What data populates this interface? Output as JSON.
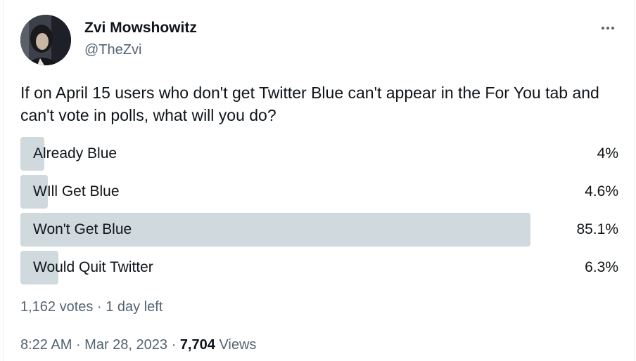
{
  "author": {
    "name": "Zvi Mowshowitz",
    "handle": "@TheZvi"
  },
  "tweet": {
    "text": "If on April 15 users who don't get Twitter Blue can't appear in the For You tab and can't vote in polls, what will you do?"
  },
  "poll": {
    "options": [
      {
        "label": "Already Blue",
        "percent_label": "4%",
        "percent": 4.0
      },
      {
        "label": "WIll Get Blue",
        "percent_label": "4.6%",
        "percent": 4.6
      },
      {
        "label": "Won't Get Blue",
        "percent_label": "85.1%",
        "percent": 85.1
      },
      {
        "label": "Would Quit Twitter",
        "percent_label": "6.3%",
        "percent": 6.3
      }
    ],
    "votes": "1,162 votes",
    "separator": " · ",
    "time_left": "1 day left"
  },
  "meta": {
    "time": "8:22 AM",
    "separator": " · ",
    "date": "Mar 28, 2023",
    "views_count": "7,704",
    "views_label": "Views"
  },
  "icons": {
    "more": "more-horizontal-icon"
  },
  "colors": {
    "text_primary": "#0f1419",
    "text_secondary": "#536471",
    "poll_bar": "#cfd9de"
  }
}
